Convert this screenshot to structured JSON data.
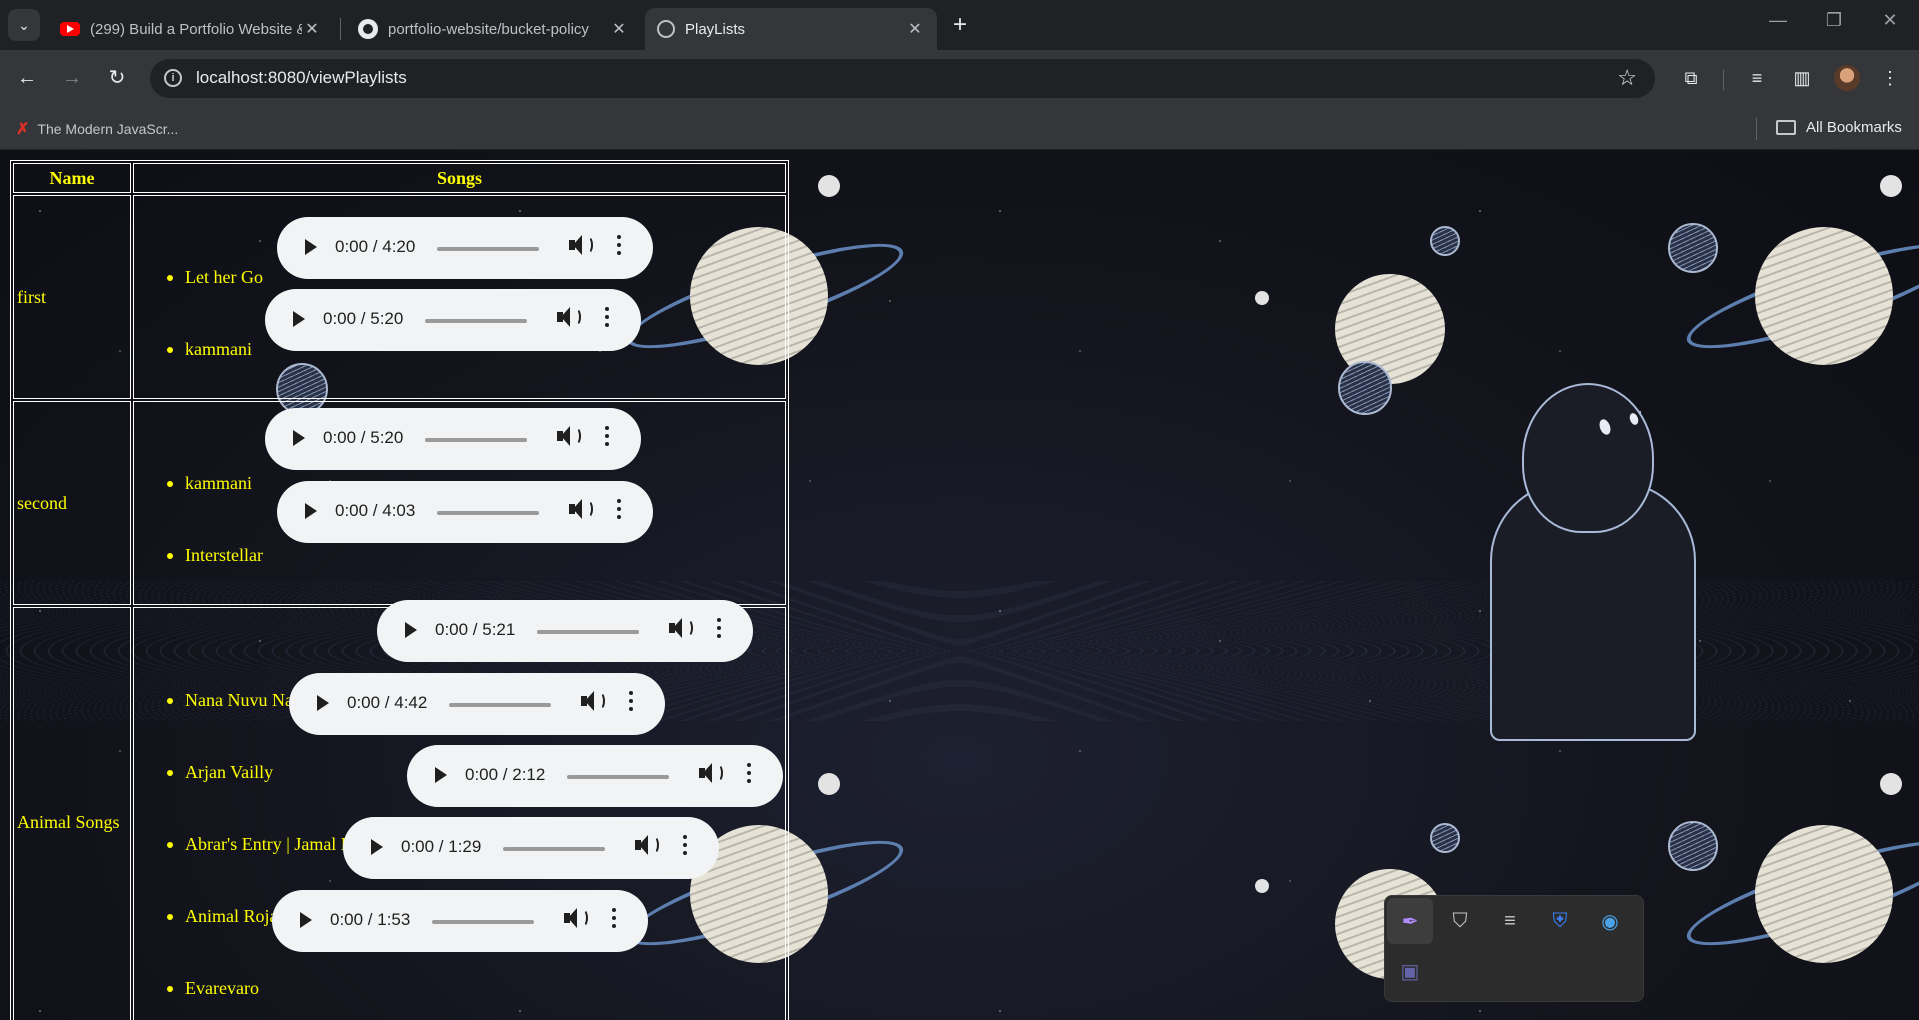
{
  "browser": {
    "tabs": [
      {
        "title": "(299) Build a Portfolio Website &",
        "favicon": "youtube-icon",
        "active": false
      },
      {
        "title": "portfolio-website/bucket-policy",
        "favicon": "github-icon",
        "active": false
      },
      {
        "title": "PlayLists",
        "favicon": "globe-icon",
        "active": true
      }
    ],
    "url": "localhost:8080/viewPlaylists",
    "bookmarks": [
      {
        "label": "The Modern JavaScr..."
      }
    ],
    "all_bookmarks_label": "All Bookmarks"
  },
  "page": {
    "headers": {
      "name": "Name",
      "songs": "Songs"
    },
    "playlists": [
      {
        "name": "first",
        "songs": [
          {
            "title": "Let her Go",
            "time": "0:00 / 4:20"
          },
          {
            "title": "kammani",
            "time": "0:00 / 5:20"
          }
        ]
      },
      {
        "name": "second",
        "songs": [
          {
            "title": "kammani",
            "time": "0:00 / 5:20"
          },
          {
            "title": "Interstellar",
            "time": "0:00 / 4:03"
          }
        ]
      },
      {
        "name": "Animal Songs",
        "songs": [
          {
            "title": "Nana Nuvu Na Pranam",
            "time": "0:00 / 5:21"
          },
          {
            "title": "Arjan Vailly",
            "time": "0:00 / 4:42"
          },
          {
            "title": "Abrar's Entry | Jamal Entry",
            "time": "0:00 / 2:12"
          },
          {
            "title": "Animal Roja BGM",
            "time": "0:00 / 1:29"
          },
          {
            "title": "Evarevaro",
            "time": "0:00 / 1:53"
          }
        ]
      }
    ]
  },
  "tray_icons": [
    "feather-icon",
    "mcafee-icon",
    "media-icon",
    "defender-warning-icon",
    "browser-icon",
    "teams-icon"
  ],
  "colors": {
    "accent_text": "#ffff00",
    "chrome_dark": "#202124",
    "chrome": "#35363a"
  }
}
